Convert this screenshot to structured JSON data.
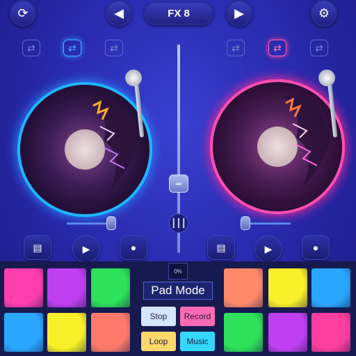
{
  "header": {
    "fx_label": "FX 8",
    "prev_icon": "triangle-left-icon",
    "next_icon": "triangle-right-icon",
    "refresh_icon": "refresh-icon",
    "settings_icon": "gear-icon"
  },
  "colors": {
    "left_deck_glow": "#1fb6ff",
    "right_deck_glow": "#ff4fb0"
  },
  "crossfader": {
    "percent_label": "0%"
  },
  "pad_panel": {
    "mode_label": "Pad Mode",
    "stop_label": "Stop",
    "record_label": "Record",
    "loop_label": "Loop",
    "music_label": "Music",
    "left_pads": [
      "#ff3fb0",
      "#c03ff0",
      "#2ee05a",
      "#2aa8ff",
      "#f7f02a",
      "#ff7a6a"
    ],
    "right_pads": [
      "#ff8a6a",
      "#f7f02a",
      "#2aa8ff",
      "#2ee05a",
      "#c03ff0",
      "#ff3fa0"
    ]
  }
}
